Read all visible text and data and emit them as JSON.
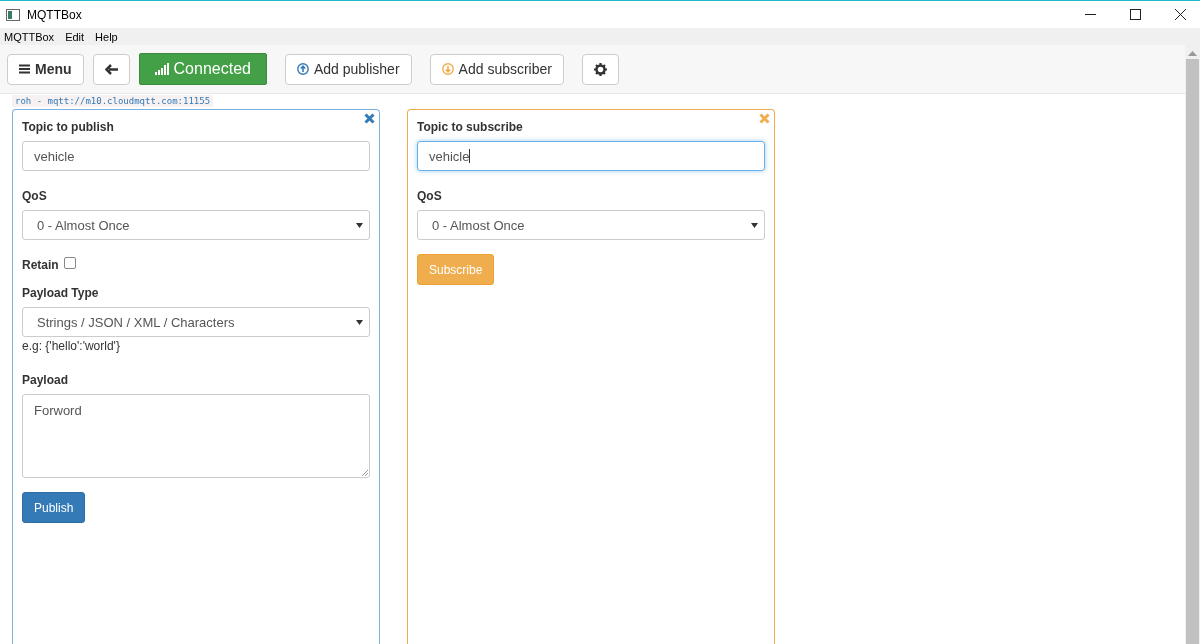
{
  "window": {
    "title": "MQTTBox"
  },
  "menu_bar": [
    "MQTTBox",
    "Edit",
    "Help"
  ],
  "toolbar": {
    "menu_button": "Menu",
    "status_button": {
      "label": "Connected",
      "connected": true
    },
    "add_publisher": "Add publisher",
    "add_subscriber": "Add subscriber"
  },
  "connection_label": "roh - mqtt://m10.cloudmqtt.com:11155",
  "panels": [
    {
      "kind": "publisher",
      "fields": [
        {
          "kind": "text",
          "label": "Topic to publish",
          "value": "vehicle",
          "focused": false
        },
        {
          "kind": "select",
          "label": "QoS",
          "value": "0 - Almost Once"
        },
        {
          "kind": "checkbox",
          "label": "Retain",
          "checked": false
        },
        {
          "kind": "select",
          "label": "Payload Type",
          "value": "Strings / JSON / XML / Characters",
          "hint": "e.g: {'hello':'world'}"
        },
        {
          "kind": "textarea",
          "label": "Payload",
          "value": "Forword"
        }
      ],
      "button": "Publish"
    },
    {
      "kind": "subscriber",
      "fields": [
        {
          "kind": "text",
          "label": "Topic to subscribe",
          "value": "vehicle",
          "focused": true
        },
        {
          "kind": "select",
          "label": "QoS",
          "value": "0 - Almost Once"
        }
      ],
      "button": "Subscribe"
    }
  ]
}
